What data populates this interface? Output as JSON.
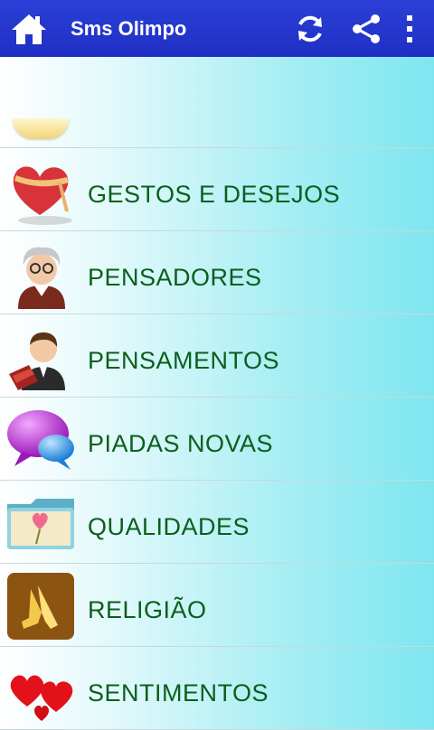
{
  "app": {
    "title": "Sms Olimpo"
  },
  "toolbar": {
    "home_icon": "home-icon",
    "refresh_icon": "refresh-icon",
    "share_icon": "share-icon",
    "menu_icon": "overflow-menu-icon"
  },
  "colors": {
    "actionbar": "#2236cf",
    "label_text": "#0b5f1c",
    "background_end": "#7ee6ef"
  },
  "categories": [
    {
      "label": "GESTOS E DESEJOS",
      "icon": "heart-gift-icon"
    },
    {
      "label": "PENSADORES",
      "icon": "thinker-avatar-icon"
    },
    {
      "label": "PENSAMENTOS",
      "icon": "man-with-book-icon"
    },
    {
      "label": "PIADAS NOVAS",
      "icon": "speech-bubbles-icon"
    },
    {
      "label": "QUALIDADES",
      "icon": "heart-folder-icon"
    },
    {
      "label": "RELIGIÃO",
      "icon": "praying-hands-icon"
    },
    {
      "label": "SENTIMENTOS",
      "icon": "hearts-icon"
    }
  ]
}
